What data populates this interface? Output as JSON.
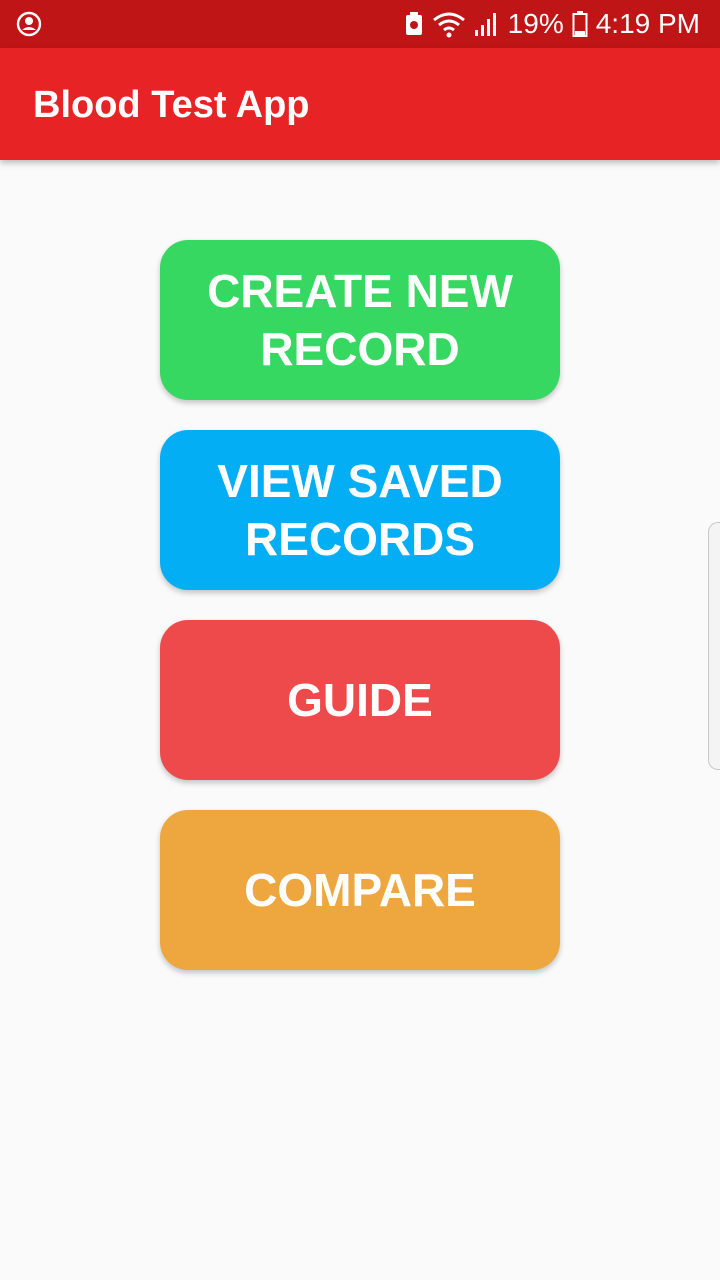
{
  "status_bar": {
    "battery_percent": "19%",
    "time": "4:19 PM",
    "icons": [
      "account-circle-icon",
      "battery-saver-icon",
      "wifi-icon",
      "signal-icon",
      "battery-icon"
    ]
  },
  "app_bar": {
    "title": "Blood Test App",
    "color": "#e72325"
  },
  "menu": {
    "create_label": "CREATE NEW RECORD",
    "view_label": "VIEW SAVED RECORDS",
    "guide_label": "GUIDE",
    "compare_label": "COMPARE"
  },
  "colors": {
    "create": "#37d862",
    "view": "#03aef4",
    "guide": "#ee4a4c",
    "compare": "#eda73e",
    "status_bar": "#c01517"
  }
}
